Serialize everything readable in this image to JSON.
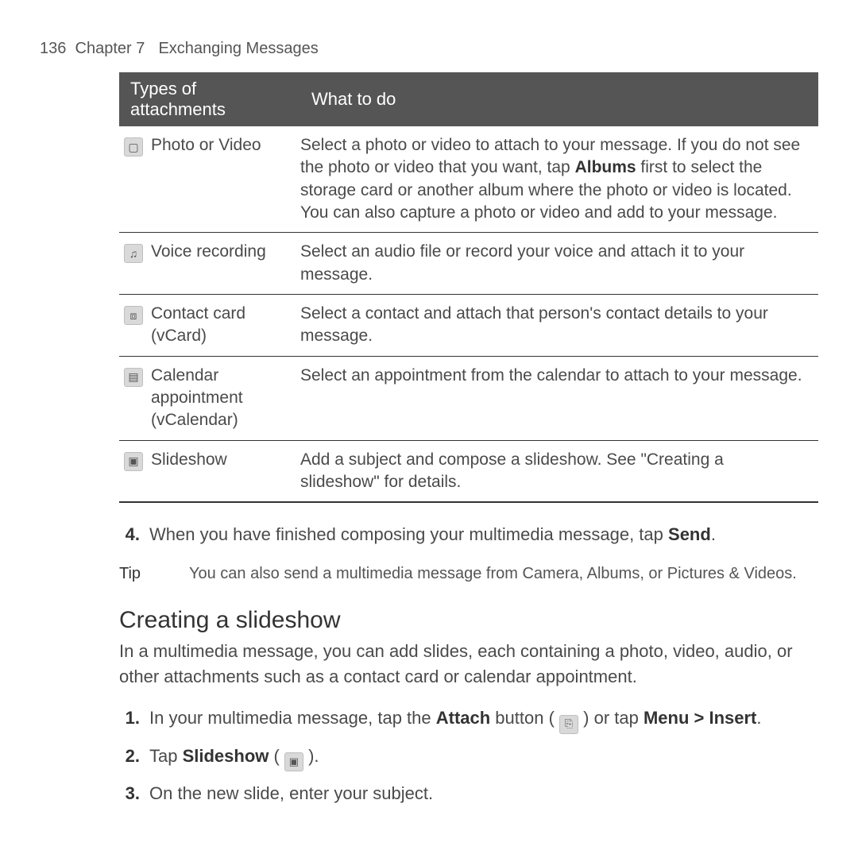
{
  "header": {
    "page_number": "136",
    "chapter": "Chapter 7",
    "chapter_title": "Exchanging Messages"
  },
  "table": {
    "headers": {
      "col1": "Types of attachments",
      "col2": "What to do"
    },
    "rows": [
      {
        "icon": "photo-video-icon",
        "glyph": "▢",
        "label": "Photo or Video",
        "desc_pre": "Select a photo or video to attach to your message. If you do not see the photo or video that you want, tap ",
        "desc_bold": "Albums",
        "desc_post": " first to select the storage card or another album where the photo or video is located. You can also capture a photo or video and add to your message."
      },
      {
        "icon": "voice-recording-icon",
        "glyph": "♫",
        "label": "Voice recording",
        "desc": "Select an audio file or record your voice and attach it to your message."
      },
      {
        "icon": "contact-card-icon",
        "glyph": "⧈",
        "label": "Contact card (vCard)",
        "desc": "Select a contact and attach that person's contact details to your message."
      },
      {
        "icon": "calendar-icon",
        "glyph": "▤",
        "label": "Calendar appointment (vCalendar)",
        "desc": "Select an appointment from the calendar to attach to your message."
      },
      {
        "icon": "slideshow-icon",
        "glyph": "▣",
        "label": "Slideshow",
        "desc": "Add a subject and compose a slideshow. See \"Creating a slideshow\" for details."
      }
    ]
  },
  "step4": {
    "num": "4.",
    "text_pre": "When you have finished composing your multimedia message, tap ",
    "text_bold": "Send",
    "text_post": "."
  },
  "tip": {
    "label": "Tip",
    "text": "You can also send a multimedia message from Camera, Albums, or Pictures & Videos."
  },
  "section": {
    "title": "Creating a slideshow",
    "desc": "In a multimedia message, you can add slides, each containing a photo, video, audio, or other attachments such as a contact card or calendar appointment.",
    "steps": [
      {
        "num": "1.",
        "pre": "In your multimedia message, tap the ",
        "b1": "Attach",
        "mid": " button ( ",
        "icon1": "attach-icon",
        "glyph1": "⎘",
        "mid2": " ) or tap ",
        "b2": "Menu > Insert",
        "post": "."
      },
      {
        "num": "2.",
        "pre": "Tap ",
        "b1": "Slideshow",
        "mid": " ( ",
        "icon1": "slideshow-small-icon",
        "glyph1": "▣",
        "post": " )."
      },
      {
        "num": "3.",
        "text": "On the new slide, enter your subject."
      }
    ]
  }
}
